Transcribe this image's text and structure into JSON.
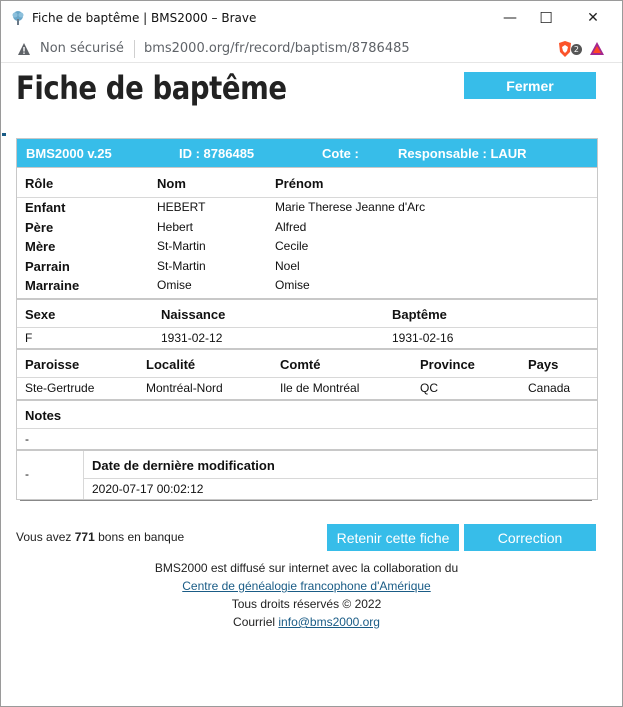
{
  "window": {
    "title": "Fiche de baptême | BMS2000 – Brave",
    "minimize_glyph": "—",
    "maximize_glyph": "☐",
    "close_glyph": "✕"
  },
  "addressbar": {
    "security_label": "Non sécurisé",
    "url": "bms2000.org/fr/record/baptism/8786485",
    "shield_badge": "2"
  },
  "page": {
    "heading": "Fiche de baptême",
    "close_button": "Fermer"
  },
  "record": {
    "version": "BMS2000 v.25",
    "id_label": "ID : 8786485",
    "cote_label": "Cote :",
    "responsable_label": "Responsable : LAUR",
    "persons_headers": [
      "Rôle",
      "Nom",
      "Prénom"
    ],
    "persons": [
      {
        "role": "Enfant",
        "nom": "HEBERT",
        "prenom": "Marie Therese Jeanne d'Arc"
      },
      {
        "role": "Père",
        "nom": "Hebert",
        "prenom": "Alfred"
      },
      {
        "role": "Mère",
        "nom": "St-Martin",
        "prenom": "Cecile"
      },
      {
        "role": "Parrain",
        "nom": "St-Martin",
        "prenom": "Noel"
      },
      {
        "role": "Marraine",
        "nom": "Omise",
        "prenom": "Omise"
      }
    ],
    "events_headers": [
      "Sexe",
      "Naissance",
      "Baptême"
    ],
    "events_values": [
      "F",
      "1931-02-12",
      "1931-02-16"
    ],
    "place_headers": [
      "Paroisse",
      "Localité",
      "Comté",
      "Province",
      "Pays"
    ],
    "place_values": [
      "Ste-Gertrude",
      "Montréal-Nord",
      "Ile de Montréal",
      "QC",
      "Canada"
    ],
    "notes_header": "Notes",
    "notes_value": "-",
    "mod_left_value": "-",
    "mod_header": "Date de dernière modification",
    "mod_value": "2020-07-17 00:02:12"
  },
  "bank": {
    "prefix": "Vous avez",
    "count": "771",
    "suffix": "bons en banque"
  },
  "actions": {
    "retain": "Retenir cette fiche",
    "correction": "Correction"
  },
  "footer": {
    "line1": "BMS2000 est diffusé sur internet avec la collaboration du",
    "link1": "Centre de généalogie francophone d'Amérique",
    "line3": "Tous droits réservés © 2022",
    "courriel": "Courriel",
    "email": "info@bms2000.org"
  },
  "colors": {
    "accent": "#37bde9",
    "link": "#1a5c86"
  }
}
